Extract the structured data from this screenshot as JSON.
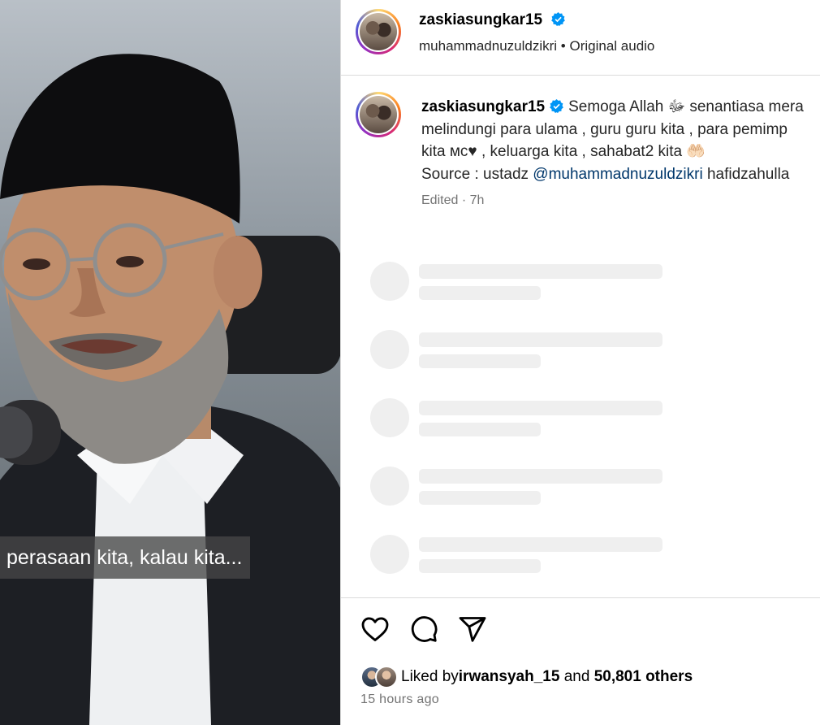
{
  "video": {
    "caption": "perasaan kita, kalau kita..."
  },
  "header": {
    "username": "zaskiasungkar15",
    "audio_user": "muhammadnuzuldzikri",
    "separator": " • ",
    "audio_label": "Original audio"
  },
  "caption": {
    "username": "zaskiasungkar15",
    "line1": "Semoga Allah ﷻ senantiasa mera",
    "line2": "melindungi para ulama , guru guru kita , para pemimp",
    "line3": "kita ᴍᴄ♥ , keluarga kita , sahabat2 kita 🤲🏻",
    "line4_prefix": "Source : ustadz ",
    "line4_mention": "@muhammadnuzuldzikri",
    "line4_suffix": " hafidzahulla",
    "meta": "Edited · 7h"
  },
  "likes": {
    "prefix": "Liked by ",
    "user": "irwansyah_15",
    "middle": " and ",
    "count": "50,801 others"
  },
  "timestamp": "15 hours ago",
  "colors": {
    "verified": "#0095f6",
    "mention": "#00376b",
    "skeleton": "#efefef",
    "muted": "#737373"
  },
  "icons": [
    "heart-icon",
    "comment-icon",
    "share-icon",
    "verified-icon"
  ]
}
